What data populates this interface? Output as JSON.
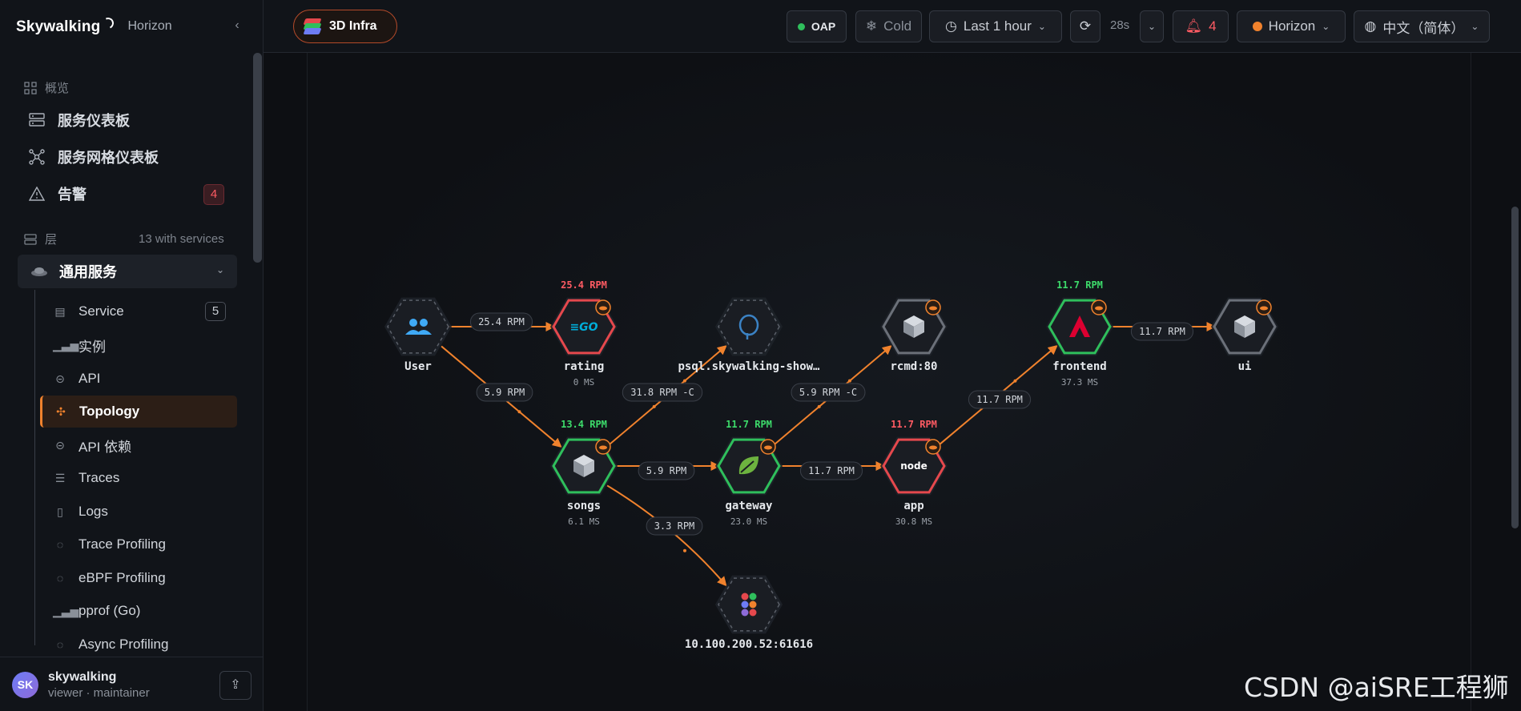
{
  "brand": {
    "logo": "Skywalking",
    "name": "Horizon"
  },
  "sidebar": {
    "overview_title": "概览",
    "main_items": [
      {
        "label": "服务仪表板"
      },
      {
        "label": "服务网格仪表板"
      },
      {
        "label": "告警",
        "badge": "4"
      }
    ],
    "layers_title": "层",
    "layers_count": "13 with services",
    "group": {
      "label": "通用服务"
    },
    "items": [
      {
        "label": "Service",
        "count": "5"
      },
      {
        "label": "实例"
      },
      {
        "label": "API"
      },
      {
        "label": "Topology",
        "active": true
      },
      {
        "label": "API 依赖"
      },
      {
        "label": "Traces"
      },
      {
        "label": "Logs"
      },
      {
        "label": "Trace Profiling"
      },
      {
        "label": "eBPF Profiling"
      },
      {
        "label": "pprof (Go)"
      },
      {
        "label": "Async Profiling"
      }
    ]
  },
  "user": {
    "initials": "SK",
    "name": "skywalking",
    "role": "viewer · maintainer"
  },
  "topbar": {
    "infra_label": "3D Infra",
    "oap_label": "OAP",
    "cold_label": "Cold",
    "time_range": "Last 1 hour",
    "refresh_interval": "28s",
    "alert_count": "4",
    "theme_label": "Horizon",
    "language": "中文（简体）"
  },
  "colors": {
    "accent": "#f0822d",
    "green": "#2fbf5c",
    "red": "#e5484d",
    "gray": "#6b7079"
  },
  "topology": {
    "nodes": [
      {
        "id": "user",
        "label": "User",
        "ms": "",
        "rpm": "",
        "status": "dashed",
        "icon": "users-icon"
      },
      {
        "id": "rating",
        "label": "rating",
        "ms": "0 MS",
        "rpm": "25.4 RPM",
        "status": "red",
        "icon": "go-icon"
      },
      {
        "id": "psql",
        "label": "psql.skywalking-show…",
        "ms": "",
        "rpm": "",
        "status": "dashed",
        "icon": "postgres-icon"
      },
      {
        "id": "rcmd",
        "label": "rcmd:80",
        "ms": "",
        "rpm": "",
        "status": "gray",
        "icon": "cube-icon"
      },
      {
        "id": "frontend",
        "label": "frontend",
        "ms": "37.3 MS",
        "rpm": "11.7 RPM",
        "status": "green",
        "icon": "angular-icon"
      },
      {
        "id": "ui",
        "label": "ui",
        "ms": "",
        "rpm": "",
        "status": "gray",
        "icon": "cube-icon"
      },
      {
        "id": "songs",
        "label": "songs",
        "ms": "6.1 MS",
        "rpm": "13.4 RPM",
        "status": "green",
        "icon": "cube-icon"
      },
      {
        "id": "gateway",
        "label": "gateway",
        "ms": "23.0 MS",
        "rpm": "11.7 RPM",
        "status": "green",
        "icon": "spring-icon"
      },
      {
        "id": "app",
        "label": "app",
        "ms": "30.8 MS",
        "rpm": "11.7 RPM",
        "status": "red",
        "icon": "node-icon"
      },
      {
        "id": "kafka",
        "label": "10.100.200.52:61616",
        "ms": "",
        "rpm": "",
        "status": "dashed",
        "icon": "activemq-icon"
      }
    ],
    "edges": [
      {
        "from": "user",
        "to": "rating",
        "label": "25.4 RPM"
      },
      {
        "from": "user",
        "to": "songs",
        "label": "5.9 RPM"
      },
      {
        "from": "songs",
        "to": "psql",
        "label": "31.8 RPM -C"
      },
      {
        "from": "gateway",
        "to": "rcmd",
        "label": "5.9 RPM -C"
      },
      {
        "from": "frontend",
        "to": "ui",
        "label": "11.7 RPM"
      },
      {
        "from": "app",
        "to": "frontend",
        "label": "11.7 RPM"
      },
      {
        "from": "songs",
        "to": "gateway",
        "label": "5.9 RPM"
      },
      {
        "from": "gateway",
        "to": "app",
        "label": "11.7 RPM"
      },
      {
        "from": "songs",
        "to": "kafka",
        "label": "3.3 RPM"
      }
    ]
  },
  "watermark": "CSDN @aiSRE工程狮"
}
